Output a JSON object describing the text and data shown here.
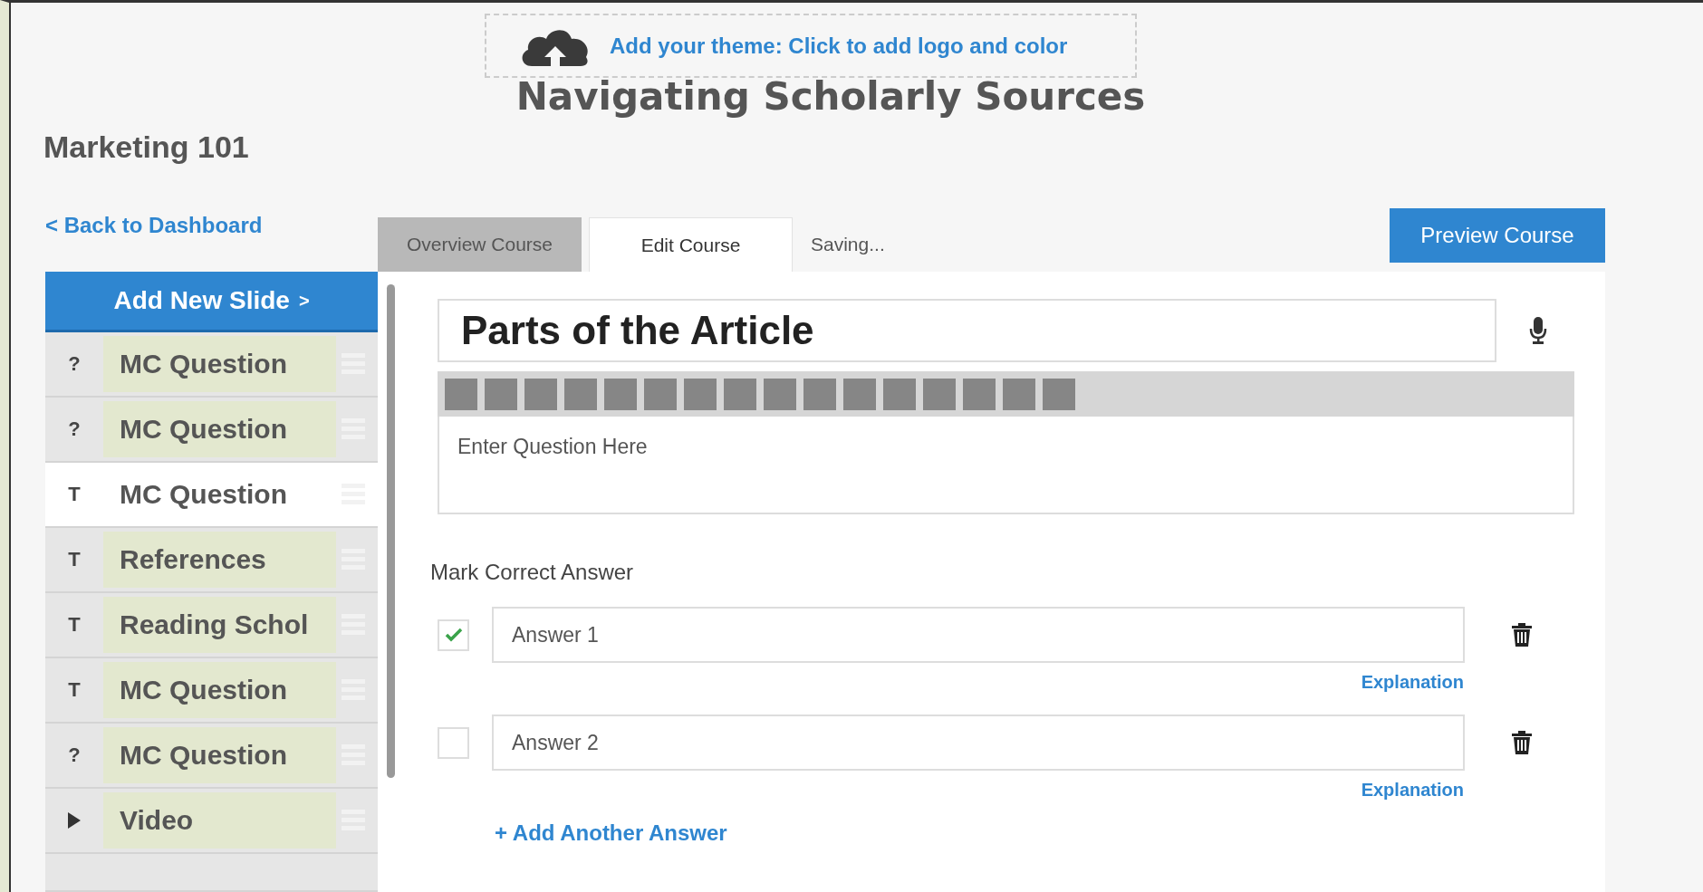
{
  "theme_banner": {
    "text": "Add your theme: Click to add logo and color"
  },
  "course_title": "Navigating Scholarly Sources",
  "course_name": "Marketing 101",
  "back_link": "< Back to Dashboard",
  "tabs": [
    {
      "label": "Overview Course",
      "selected": false
    },
    {
      "label": "Edit Course",
      "selected": true
    }
  ],
  "save_status": "Saving...",
  "preview_button": "Preview Course",
  "sidebar": {
    "add_button": "Add New Slide",
    "add_button_caret": ">",
    "slides": [
      {
        "kind": "question",
        "icon": "?",
        "label": "MC Question",
        "selected": false
      },
      {
        "kind": "question",
        "icon": "?",
        "label": "MC Question",
        "selected": false
      },
      {
        "kind": "text",
        "icon": "T",
        "label": "MC Question",
        "selected": true
      },
      {
        "kind": "text",
        "icon": "T",
        "label": "References",
        "selected": false
      },
      {
        "kind": "text",
        "icon": "T",
        "label": "Reading Schol",
        "selected": false
      },
      {
        "kind": "text",
        "icon": "T",
        "label": "MC Question",
        "selected": false
      },
      {
        "kind": "question",
        "icon": "?",
        "label": "MC Question",
        "selected": false
      },
      {
        "kind": "video",
        "label": "Video",
        "selected": false
      }
    ]
  },
  "editor": {
    "title_value": "Parts of the Article",
    "question_placeholder": "Enter Question Here",
    "answers_label": "Mark Correct Answer",
    "answers": [
      {
        "value": "Answer 1",
        "checked": true,
        "explanation": "Explanation"
      },
      {
        "value": "Answer 2",
        "checked": false,
        "explanation": "Explanation"
      }
    ],
    "add_answer": "+ Add Another Answer"
  }
}
